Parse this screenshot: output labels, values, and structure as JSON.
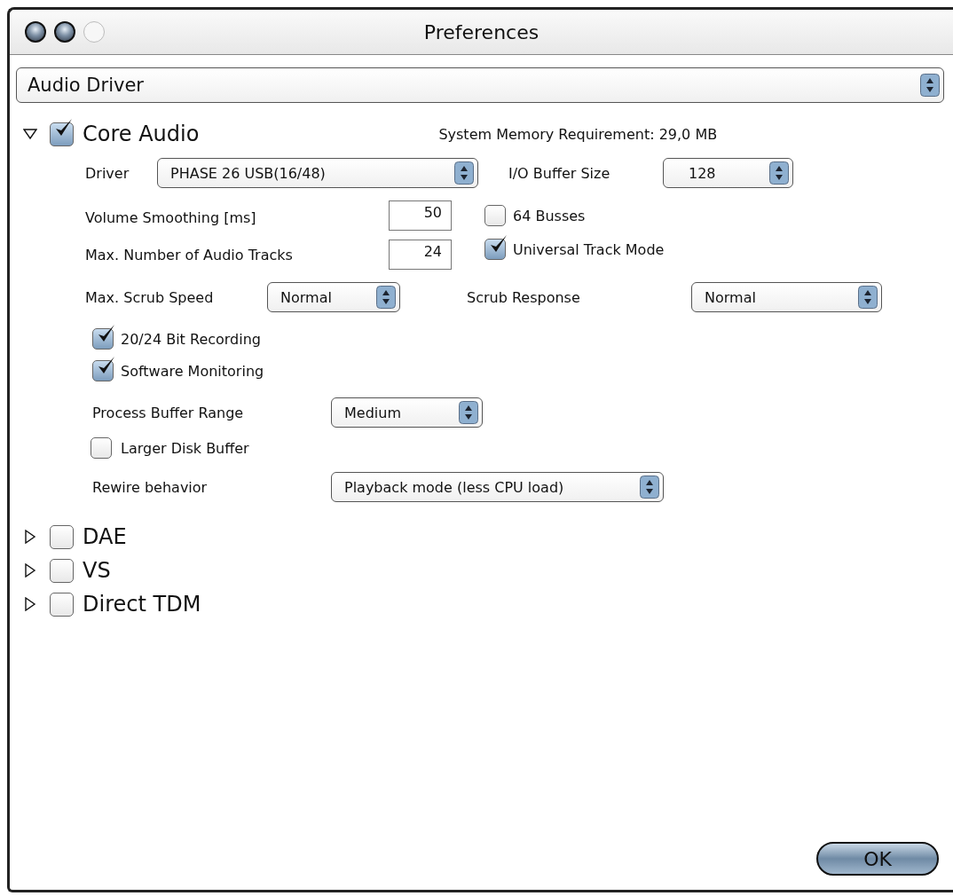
{
  "window": {
    "title": "Preferences",
    "controls": [
      {
        "disabled": false
      },
      {
        "disabled": false
      },
      {
        "disabled": true
      }
    ]
  },
  "category_popup": {
    "value": "Audio Driver"
  },
  "drivers": [
    {
      "label": "Core Audio",
      "expanded": true,
      "checked": true,
      "memory": "System Memory Requirement: 29,0 MB",
      "settings": {
        "driver": {
          "label": "Driver",
          "value": "PHASE 26 USB(16/48)"
        },
        "io_buffer": {
          "label": "I/O Buffer Size",
          "value": "128"
        },
        "volume_smoothing": {
          "label": "Volume Smoothing [ms]",
          "value": "50"
        },
        "max_tracks": {
          "label": "Max. Number of Audio Tracks",
          "value": "24"
        },
        "busses": {
          "label": "64 Busses",
          "checked": false
        },
        "universal_track_mode": {
          "label": "Universal Track Mode",
          "checked": true
        },
        "scrub_speed": {
          "label": "Max. Scrub Speed",
          "value": "Normal"
        },
        "scrub_response": {
          "label": "Scrub Response",
          "value": "Normal"
        },
        "bit_recording": {
          "label": "20/24 Bit Recording",
          "checked": true
        },
        "software_monitoring": {
          "label": "Software Monitoring",
          "checked": true
        },
        "process_buffer": {
          "label": "Process Buffer Range",
          "value": "Medium"
        },
        "larger_disk_buffer": {
          "label": "Larger Disk Buffer",
          "checked": false
        },
        "rewire": {
          "label": "Rewire behavior",
          "value": "Playback mode (less CPU load)"
        }
      }
    },
    {
      "label": "DAE",
      "expanded": false,
      "checked": false
    },
    {
      "label": "VS",
      "expanded": false,
      "checked": false
    },
    {
      "label": "Direct TDM",
      "expanded": false,
      "checked": false
    }
  ],
  "ok_button": {
    "label": "OK"
  }
}
